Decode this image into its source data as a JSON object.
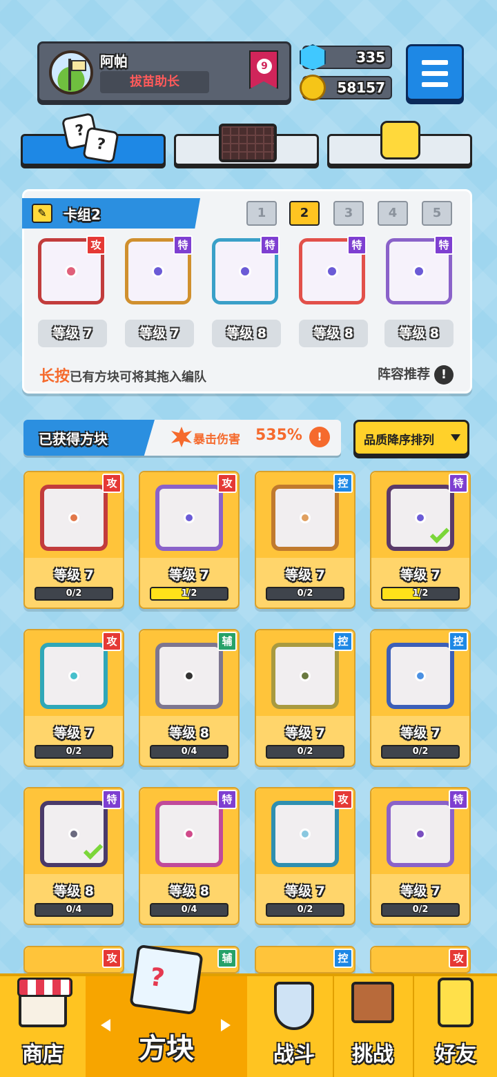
{
  "profile": {
    "name": "阿帕",
    "title": "拔苗助长",
    "rank": "9"
  },
  "currency": {
    "gems": "335",
    "coins": "58157"
  },
  "top_tabs": [
    {
      "icon": "dice-icon",
      "active": true
    },
    {
      "icon": "grid-board-icon",
      "active": false
    },
    {
      "icon": "smile-block-icon",
      "active": false
    }
  ],
  "deck": {
    "title": "卡组2",
    "numbers": [
      "1",
      "2",
      "3",
      "4",
      "5"
    ],
    "active_index": 1,
    "cards": [
      {
        "badge": "攻",
        "level": "等级 7",
        "icon": "combo-icon"
      },
      {
        "badge": "特",
        "level": "等级 7",
        "icon": "infinity-icon"
      },
      {
        "badge": "特",
        "level": "等级 8",
        "icon": "hands-icon"
      },
      {
        "badge": "特",
        "level": "等级 8",
        "icon": "rainbow-icon"
      },
      {
        "badge": "特",
        "level": "等级 8",
        "icon": "cycle-icon"
      }
    ],
    "hint_accent": "长按",
    "hint_text": "已有方块可将其拖入编队",
    "recommend_label": "阵容推荐"
  },
  "owned": {
    "title": "已获得方块",
    "crit_label": "暴击伤害",
    "crit_value": "535%",
    "sort_label": "品质降序排列"
  },
  "blocks": [
    {
      "badge": "攻",
      "level": "等级 7",
      "progress": "0/2",
      "fill": 0,
      "frame": "#c23c3c",
      "core": "#e2784a",
      "checked": false
    },
    {
      "badge": "攻",
      "level": "等级 7",
      "progress": "1/2",
      "fill": 0.5,
      "frame": "#8a62c9",
      "core": "#6b5bd6",
      "checked": false
    },
    {
      "badge": "控",
      "level": "等级 7",
      "progress": "0/2",
      "fill": 0,
      "frame": "#c07a2e",
      "core": "#e0a060",
      "checked": false
    },
    {
      "badge": "特",
      "level": "等级 7",
      "progress": "1/2",
      "fill": 0.5,
      "frame": "#5a3a6a",
      "core": "#6b5bd6",
      "checked": true
    },
    {
      "badge": "攻",
      "level": "等级 7",
      "progress": "0/2",
      "fill": 0,
      "frame": "#2fa7b8",
      "core": "#46c0cc",
      "checked": false
    },
    {
      "badge": "辅",
      "level": "等级 8",
      "progress": "0/4",
      "fill": 0,
      "frame": "#7d7690",
      "core": "#333",
      "checked": false
    },
    {
      "badge": "控",
      "level": "等级 7",
      "progress": "0/2",
      "fill": 0,
      "frame": "#a89a40",
      "core": "#6a7a40",
      "checked": false
    },
    {
      "badge": "控",
      "level": "等级 7",
      "progress": "0/2",
      "fill": 0,
      "frame": "#3c5fb8",
      "core": "#4a90e2",
      "checked": false
    },
    {
      "badge": "特",
      "level": "等级 8",
      "progress": "0/4",
      "fill": 0,
      "frame": "#4a3a6a",
      "core": "#6b6b80",
      "checked": true
    },
    {
      "badge": "特",
      "level": "等级 8",
      "progress": "0/4",
      "fill": 0,
      "frame": "#c04a9a",
      "core": "#d04a8a",
      "checked": false
    },
    {
      "badge": "攻",
      "level": "等级 7",
      "progress": "0/2",
      "fill": 0,
      "frame": "#2f8fb0",
      "core": "#8ac8e0",
      "checked": false
    },
    {
      "badge": "特",
      "level": "等级 7",
      "progress": "0/2",
      "fill": 0,
      "frame": "#8a62c9",
      "core": "#7a4fc0",
      "checked": false
    }
  ],
  "partial_row_badges": [
    "攻",
    "辅",
    "控",
    "攻"
  ],
  "bottom_nav": [
    {
      "label": "商店",
      "icon": "shop-icon",
      "active": false
    },
    {
      "label": "方块",
      "icon": "block-cube-icon",
      "active": true
    },
    {
      "label": "战斗",
      "icon": "battle-shield-icon",
      "active": false
    },
    {
      "label": "挑战",
      "icon": "challenge-sign-icon",
      "active": false
    },
    {
      "label": "好友",
      "icon": "friends-icon",
      "active": false
    }
  ]
}
